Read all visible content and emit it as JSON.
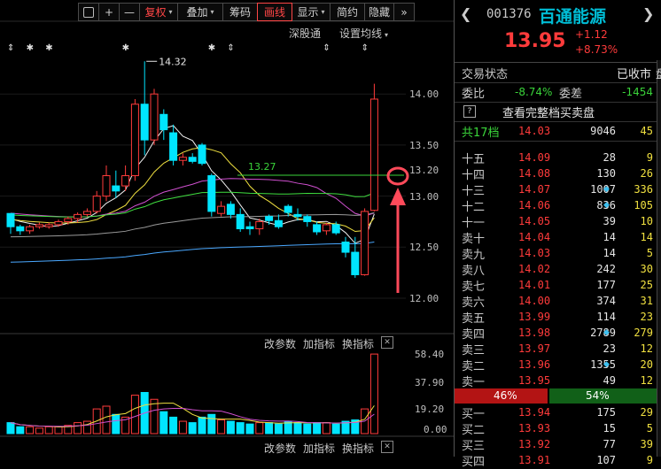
{
  "toolbar": {
    "items": [
      {
        "label": "",
        "icon": "window-icon"
      },
      {
        "label": "+"
      },
      {
        "label": "—"
      },
      {
        "label": "复权",
        "caret": true,
        "color": "red"
      },
      {
        "label": "叠加",
        "caret": true
      },
      {
        "label": "筹码"
      },
      {
        "label": "画线",
        "active": true
      },
      {
        "label": "显示",
        "caret": true
      },
      {
        "label": "简约"
      },
      {
        "label": "隐藏"
      },
      {
        "label": "»"
      }
    ]
  },
  "chart_header": {
    "indicator_name": "深股通",
    "settings_label": "设置均线"
  },
  "price_axis": [
    "14.00",
    "13.50",
    "13.20",
    "13.00",
    "12.50",
    "12.00"
  ],
  "annotations": {
    "high_label": "14.32",
    "line_label": "13.27"
  },
  "volume_axis": [
    "58.40",
    "37.90",
    "19.20",
    "0.00"
  ],
  "indicator_bar": {
    "params": "改参数",
    "add": "加指标",
    "switch": "换指标"
  },
  "chart_data": {
    "type": "candlestick",
    "ylim": [
      12.0,
      14.4
    ],
    "ohlc": [
      [
        12.83,
        12.83,
        12.63,
        12.7
      ],
      [
        12.7,
        12.72,
        12.62,
        12.66
      ],
      [
        12.66,
        12.72,
        12.63,
        12.7
      ],
      [
        12.7,
        12.74,
        12.68,
        12.72
      ],
      [
        12.7,
        12.74,
        12.68,
        12.72
      ],
      [
        12.72,
        12.77,
        12.7,
        12.75
      ],
      [
        12.75,
        12.8,
        12.72,
        12.78
      ],
      [
        12.78,
        12.84,
        12.74,
        12.82
      ],
      [
        12.82,
        12.88,
        12.8,
        12.85
      ],
      [
        12.85,
        13.05,
        12.83,
        13.0
      ],
      [
        13.0,
        13.3,
        12.95,
        13.2
      ],
      [
        13.1,
        13.25,
        12.98,
        13.05
      ],
      [
        13.1,
        13.3,
        13.05,
        13.2
      ],
      [
        13.2,
        13.95,
        13.15,
        13.9
      ],
      [
        13.9,
        14.32,
        13.4,
        13.55
      ],
      [
        13.55,
        14.05,
        13.5,
        14.0
      ],
      [
        13.8,
        13.85,
        13.55,
        13.65
      ],
      [
        13.62,
        13.7,
        13.3,
        13.35
      ],
      [
        13.35,
        13.42,
        13.3,
        13.38
      ],
      [
        13.38,
        13.42,
        13.32,
        13.34
      ],
      [
        13.5,
        13.52,
        13.3,
        13.32
      ],
      [
        13.2,
        13.22,
        12.8,
        12.85
      ],
      [
        12.83,
        12.95,
        12.8,
        12.9
      ],
      [
        12.92,
        12.95,
        12.78,
        12.82
      ],
      [
        12.82,
        12.88,
        12.65,
        12.68
      ],
      [
        12.7,
        12.75,
        12.62,
        12.68
      ],
      [
        12.68,
        12.78,
        12.62,
        12.75
      ],
      [
        12.8,
        12.82,
        12.72,
        12.76
      ],
      [
        12.76,
        12.82,
        12.68,
        12.7
      ],
      [
        12.9,
        12.92,
        12.8,
        12.84
      ],
      [
        12.82,
        12.88,
        12.76,
        12.8
      ],
      [
        12.8,
        12.82,
        12.7,
        12.75
      ],
      [
        12.72,
        12.75,
        12.62,
        12.65
      ],
      [
        12.66,
        12.74,
        12.62,
        12.72
      ],
      [
        12.72,
        12.75,
        12.62,
        12.64
      ],
      [
        12.55,
        12.6,
        12.4,
        12.45
      ],
      [
        12.45,
        12.6,
        12.2,
        12.23
      ],
      [
        12.23,
        12.88,
        12.22,
        12.85
      ],
      [
        12.86,
        14.1,
        12.85,
        13.95
      ]
    ],
    "volume": [
      8,
      5,
      5,
      4,
      5,
      5,
      6,
      8,
      9,
      18,
      20,
      14,
      12,
      28,
      30,
      25,
      16,
      12,
      9,
      8,
      12,
      14,
      10,
      9,
      8,
      7,
      8,
      8,
      7,
      9,
      8,
      7,
      8,
      8,
      7,
      9,
      10,
      18,
      58
    ]
  },
  "quote": {
    "code": "001376",
    "name": "百通能源",
    "price": "13.95",
    "change": "+1.12",
    "change_pct": "+8.73%",
    "trade_status_label": "交易状态",
    "trade_status_value": "已收市",
    "weibi_label": "委比",
    "weibi_value": "-8.74%",
    "weicha_label": "委差",
    "weicha_value": "-1454",
    "help_icon_text": "?",
    "full_book_label": "查看完整档买卖盘",
    "total_levels_label": "共17档",
    "total_levels_price": "14.03",
    "total_levels_vol": "9046",
    "total_levels_chg": "45",
    "side_tab": "盘"
  },
  "order_book": {
    "asks": [
      {
        "label": "十五",
        "price": "14.09",
        "vol": "28",
        "dia": false,
        "chg": "9"
      },
      {
        "label": "十四",
        "price": "14.08",
        "vol": "130",
        "dia": false,
        "chg": "26"
      },
      {
        "label": "十三",
        "price": "14.07",
        "vol": "1007",
        "dia": true,
        "chg": "336"
      },
      {
        "label": "十二",
        "price": "14.06",
        "vol": "836",
        "dia": true,
        "chg": "105"
      },
      {
        "label": "十一",
        "price": "14.05",
        "vol": "39",
        "dia": false,
        "chg": "10"
      },
      {
        "label": "卖十",
        "price": "14.04",
        "vol": "14",
        "dia": false,
        "chg": "14"
      },
      {
        "label": "卖九",
        "price": "14.03",
        "vol": "14",
        "dia": false,
        "chg": "5"
      },
      {
        "label": "卖八",
        "price": "14.02",
        "vol": "242",
        "dia": false,
        "chg": "30"
      },
      {
        "label": "卖七",
        "price": "14.01",
        "vol": "177",
        "dia": false,
        "chg": "25"
      },
      {
        "label": "卖六",
        "price": "14.00",
        "vol": "374",
        "dia": false,
        "chg": "31"
      },
      {
        "label": "卖五",
        "price": "13.99",
        "vol": "114",
        "dia": false,
        "chg": "23"
      },
      {
        "label": "卖四",
        "price": "13.98",
        "vol": "2789",
        "dia": true,
        "chg": "279"
      },
      {
        "label": "卖三",
        "price": "13.97",
        "vol": "23",
        "dia": false,
        "chg": "12"
      },
      {
        "label": "卖二",
        "price": "13.96",
        "vol": "1355",
        "dia": true,
        "chg": "20"
      },
      {
        "label": "卖一",
        "price": "13.95",
        "vol": "49",
        "dia": false,
        "chg": "12"
      }
    ],
    "ratio_left": "46%",
    "ratio_right": "54%",
    "ratio_fraction": 0.46,
    "bids": [
      {
        "label": "买一",
        "price": "13.94",
        "vol": "175",
        "dia": false,
        "chg": "29"
      },
      {
        "label": "买二",
        "price": "13.93",
        "vol": "15",
        "dia": false,
        "chg": "5"
      },
      {
        "label": "买三",
        "price": "13.92",
        "vol": "77",
        "dia": false,
        "chg": "39"
      },
      {
        "label": "买四",
        "price": "13.91",
        "vol": "107",
        "dia": false,
        "chg": "9"
      }
    ]
  },
  "colors": {
    "up": "#ff3b3b",
    "down": "#00e5ff",
    "accent": "#00bcd4",
    "green": "#3ad43a",
    "marker": "#ff4a5a"
  }
}
